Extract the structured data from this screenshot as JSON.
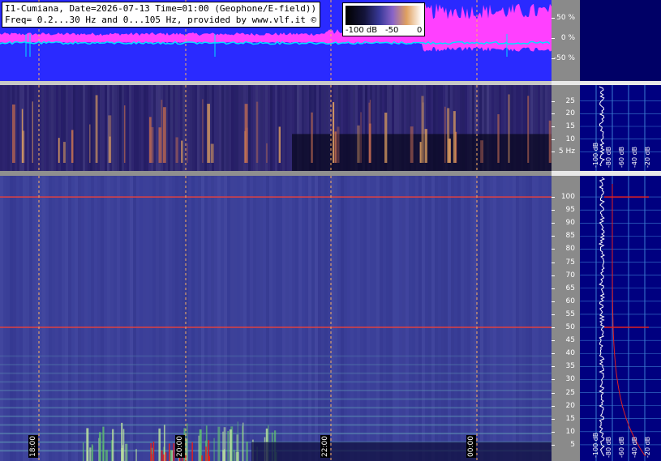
{
  "header": {
    "line1": "I1-Cumiana, Date=2026-07-13 Time=01:00 (Geophone/E-field))",
    "line2": "Freq= 0.2...30 Hz and 0...105 Hz, provided by www.vlf.it ©"
  },
  "colorbar": {
    "labels": [
      "-100 dB",
      "-50",
      "0"
    ]
  },
  "chart_data": [
    {
      "type": "line",
      "title": "",
      "yticks": [
        "50 %",
        "0 %",
        "-50 %"
      ],
      "series_colors": {
        "envelope": "#ff40ff",
        "trace": "#00e0ff",
        "background": "#2a2aff"
      }
    },
    {
      "type": "heatmap",
      "title": "",
      "yunit": "Hz",
      "yrange": [
        0,
        30
      ],
      "yticks": [
        25,
        20,
        15,
        10,
        5
      ],
      "ytick_labels": [
        "25",
        "20",
        "15",
        "10",
        "5 Hz"
      ],
      "side_xticks": [
        "-100 dB",
        "-80 dB",
        "-60 dB",
        "-40 dB",
        "-20 dB"
      ]
    },
    {
      "type": "heatmap",
      "title": "",
      "yrange": [
        0,
        105
      ],
      "yticks": [
        100,
        95,
        90,
        85,
        80,
        75,
        70,
        65,
        60,
        55,
        50,
        45,
        40,
        35,
        30,
        25,
        20,
        15,
        10,
        5
      ],
      "ytick_labels": [
        "100",
        "95",
        "90",
        "85",
        "80",
        "75",
        "70",
        "65",
        "60",
        "55",
        "50",
        "45",
        "40",
        "35",
        "30",
        "25",
        "20",
        "15",
        "10",
        "5"
      ],
      "side_xticks": [
        "-100 dB",
        "-80 dB",
        "-60 dB",
        "-40 dB",
        "-20 dB"
      ],
      "lines": [
        100,
        50
      ]
    }
  ],
  "time_axis": {
    "labels": [
      "18:00",
      "20:00",
      "22:00",
      "00:00"
    ]
  }
}
